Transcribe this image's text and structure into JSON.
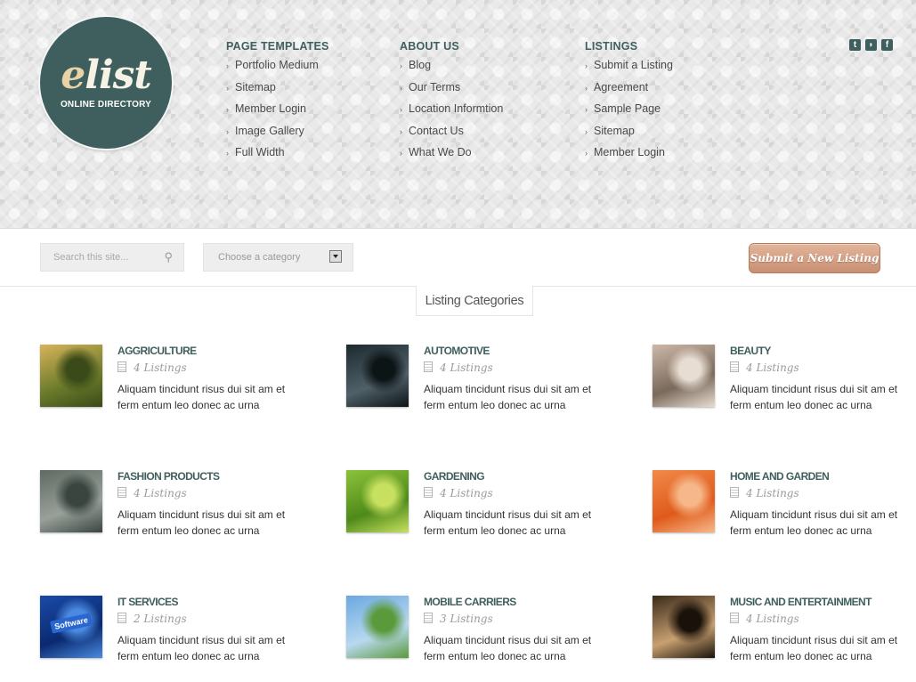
{
  "logo": {
    "first_letter": "e",
    "rest": "list",
    "subtitle": "ONLINE DIRECTORY"
  },
  "nav": [
    {
      "heading": "PAGE TEMPLATES",
      "items": [
        "Portfolio Medium",
        "Sitemap",
        "Member Login",
        "Image Gallery",
        "Full Width"
      ]
    },
    {
      "heading": "ABOUT US",
      "items": [
        "Blog",
        "Our Terms",
        "Location Informtion",
        "Contact Us",
        "What We Do"
      ]
    },
    {
      "heading": "LISTINGS",
      "items": [
        "Submit a Listing",
        "Agreement",
        "Sample Page",
        "Sitemap",
        "Member Login"
      ]
    }
  ],
  "social": [
    {
      "icon": "twitter-icon",
      "glyph": "t"
    },
    {
      "icon": "rss-icon",
      "glyph": "◗"
    },
    {
      "icon": "facebook-icon",
      "glyph": "f"
    }
  ],
  "search": {
    "placeholder": "Search this site...",
    "icon": "search-icon"
  },
  "category_select": {
    "value": "Choose a category"
  },
  "submit_button": "Submit a New Listing",
  "categories_tab": "Listing Categories",
  "categories": [
    {
      "title": "AGGRICULTURE",
      "count": "4 Listings",
      "desc": "Aliquam tincidunt risus dui sit am et ferm entum leo donec ac urna",
      "image": "agriculture-tractor-image",
      "colors": [
        "#d8b35a",
        "#6a7a2a",
        "#3a4a18"
      ]
    },
    {
      "title": "AUTOMOTIVE",
      "count": "4 Listings",
      "desc": "Aliquam tincidunt risus dui sit am et ferm entum leo donec ac urna",
      "image": "automotive-headlight-image",
      "colors": [
        "#1c2a2e",
        "#4f6068",
        "#0d1416"
      ]
    },
    {
      "title": "BEAUTY",
      "count": "4 Listings",
      "desc": "Aliquam tincidunt risus dui sit am et ferm entum leo donec ac urna",
      "image": "beauty-woman-image",
      "colors": [
        "#cdb8a8",
        "#7a6a5c",
        "#e8ddd2"
      ]
    },
    {
      "title": "FASHION PRODUCTS",
      "count": "4 Listings",
      "desc": "Aliquam tincidunt risus dui sit am et ferm entum leo donec ac urna",
      "image": "fashion-model-image",
      "colors": [
        "#5f6a62",
        "#99a09a",
        "#3a4540"
      ]
    },
    {
      "title": "GARDENING",
      "count": "4 Listings",
      "desc": "Aliquam tincidunt risus dui sit am et ferm entum leo donec ac urna",
      "image": "gardening-ladybug-image",
      "colors": [
        "#8cc23a",
        "#4e8a1a",
        "#c8e060"
      ]
    },
    {
      "title": "HOME AND GARDEN",
      "count": "4 Listings",
      "desc": "Aliquam tincidunt risus dui sit am et ferm entum leo donec ac urna",
      "image": "home-chair-image",
      "colors": [
        "#f08a4a",
        "#e05a1a",
        "#f6b88a"
      ]
    },
    {
      "title": "IT SERVICES",
      "count": "2 Listings",
      "desc": "Aliquam tincidunt risus dui sit am et ferm entum leo donec ac urna",
      "image": "it-software-key-image",
      "colors": [
        "#1a4aa8",
        "#0a2a70",
        "#4a8ae0"
      ],
      "label": "Software"
    },
    {
      "title": "MOBILE CARRIERS",
      "count": "3 Listings",
      "desc": "Aliquam tincidunt risus dui sit am et ferm entum leo donec ac urna",
      "image": "mobile-phone-image",
      "colors": [
        "#6aa8e0",
        "#b8d8f0",
        "#5a9a3a"
      ]
    },
    {
      "title": "MUSIC AND ENTERTAINMENT",
      "count": "4 Listings",
      "desc": "Aliquam tincidunt risus dui sit am et ferm entum leo donec ac urna",
      "image": "music-singer-image",
      "colors": [
        "#3a2a1a",
        "#c8a070",
        "#1a120a"
      ]
    }
  ]
}
